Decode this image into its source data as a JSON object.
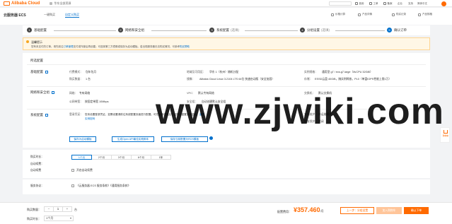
{
  "topbar": {
    "logo": "Alibaba Cloud",
    "home": "华东全部资源",
    "nav": [
      "费用",
      "工单",
      "备案",
      "企业",
      "支持",
      "简体中文"
    ]
  },
  "header": {
    "title": "云服务器 ECS",
    "tabs": [
      "一键购买",
      "自定义购买"
    ],
    "right": [
      "价格计算",
      "产品详情",
      "购买记录",
      "产品规格"
    ]
  },
  "steps": [
    {
      "num": "1",
      "label": "基础配置",
      "optional": ""
    },
    {
      "num": "2",
      "label": "网络和安全组",
      "optional": ""
    },
    {
      "num": "3",
      "label": "系统配置",
      "optional": "(选填)"
    },
    {
      "num": "4",
      "label": "分组设置",
      "optional": "(选填)"
    },
    {
      "num": "5",
      "label": "确认订单",
      "optional": ""
    }
  ],
  "notice": {
    "title": "温馨提示",
    "text_a": "您有未支付的订单。请先前往",
    "link_a": "订单管理",
    "text_b": "支付或作废后再创建；可选择第三方镜像或保存为启动模板。若出现服务器无法购买情况，可参考",
    "link_b": "购买帮助"
  },
  "config": {
    "heading": "所选配置",
    "sections": {
      "basic": "基础配置",
      "network": "网络和安全组",
      "system": "系统配置"
    },
    "basic": {
      "billing_label": "付费模式：",
      "billing_value": "包年包月",
      "region_label": "地域及可用区：",
      "region_value": "华东 1（杭州）随机分配",
      "instance_label": "实例规格：",
      "instance_value": "通用型 g7 / ecs.g7.large（8vCPU 32GiB）",
      "qty_label": "购买数量：",
      "qty_value": "1 台",
      "image_label": "镜像：",
      "image_value": "Alibaba Cloud Linux 3.2104 LTS 64位 快速启动版（安全加固）",
      "disk_label": "存储：",
      "disk_value": "ESSD云盘 40GiB，随实例释放，PL0（单盘IOPS性能上限1万）"
    },
    "network": {
      "net_label": "网络：",
      "net_value": "专有网络",
      "vpc_label": "VPC：",
      "vpc_value": "默认专有网络",
      "switch_label": "交换机：",
      "switch_value": "默认交换机",
      "bw_label": "公网带宽：",
      "bw_value": "按固定带宽 10Mbps",
      "sg_label": "安全组：",
      "sg_value": "自动创建默认安全组"
    },
    "system": {
      "login_label": "登录凭证：",
      "login_value": "您未设置登录凭证，如需设置请前往系统配置页面进行配置。可在实例创建后于控制台重置实例密码。",
      "login_link": "重置实例密码",
      "host_label": "主机名：",
      "host_value": "默认分配",
      "name_label": "实例名称：",
      "name_value": "默认分配",
      "maintain_label": "实例维护：",
      "maintain_value": "非运维模式",
      "release_label": "释放保护：",
      "release_value": "关闭"
    },
    "buttons": {
      "save_template": "保存为启动模板",
      "gen_api": "生成Open API最佳实践脚本",
      "save_ros": "保存当前配置为ROS模板"
    }
  },
  "duration": {
    "label": "购买时长：",
    "options": [
      "1个月",
      "2个月",
      "3个月",
      "6个月",
      "1年"
    ],
    "billing_label": "自动续费：",
    "renew_label": "自动续费",
    "auto_renew": "开启自动续费"
  },
  "agreement": {
    "label": "服务协议：",
    "text": "《云服务器 ECS 服务条款》《通用服务条款》"
  },
  "float_tab": "购物车",
  "watermark": "www.zjwiki.com",
  "bottom": {
    "qty_label": "购买数量：",
    "qty_minus": "−",
    "qty_value": "1",
    "qty_plus": "+",
    "qty_unit": "台",
    "duration_label": "购买时长：",
    "duration_value": "1个月",
    "price_label": "配置费用：",
    "price": "¥357.460",
    "price_unit": "/月",
    "prev_button": "上一步：分组设置",
    "cart_button": "加入购物车",
    "buy_button": "确认下单"
  },
  "colors": {
    "accent": "#ff6a00",
    "link": "#0070cc",
    "notice_bg": "#fff7e6"
  }
}
